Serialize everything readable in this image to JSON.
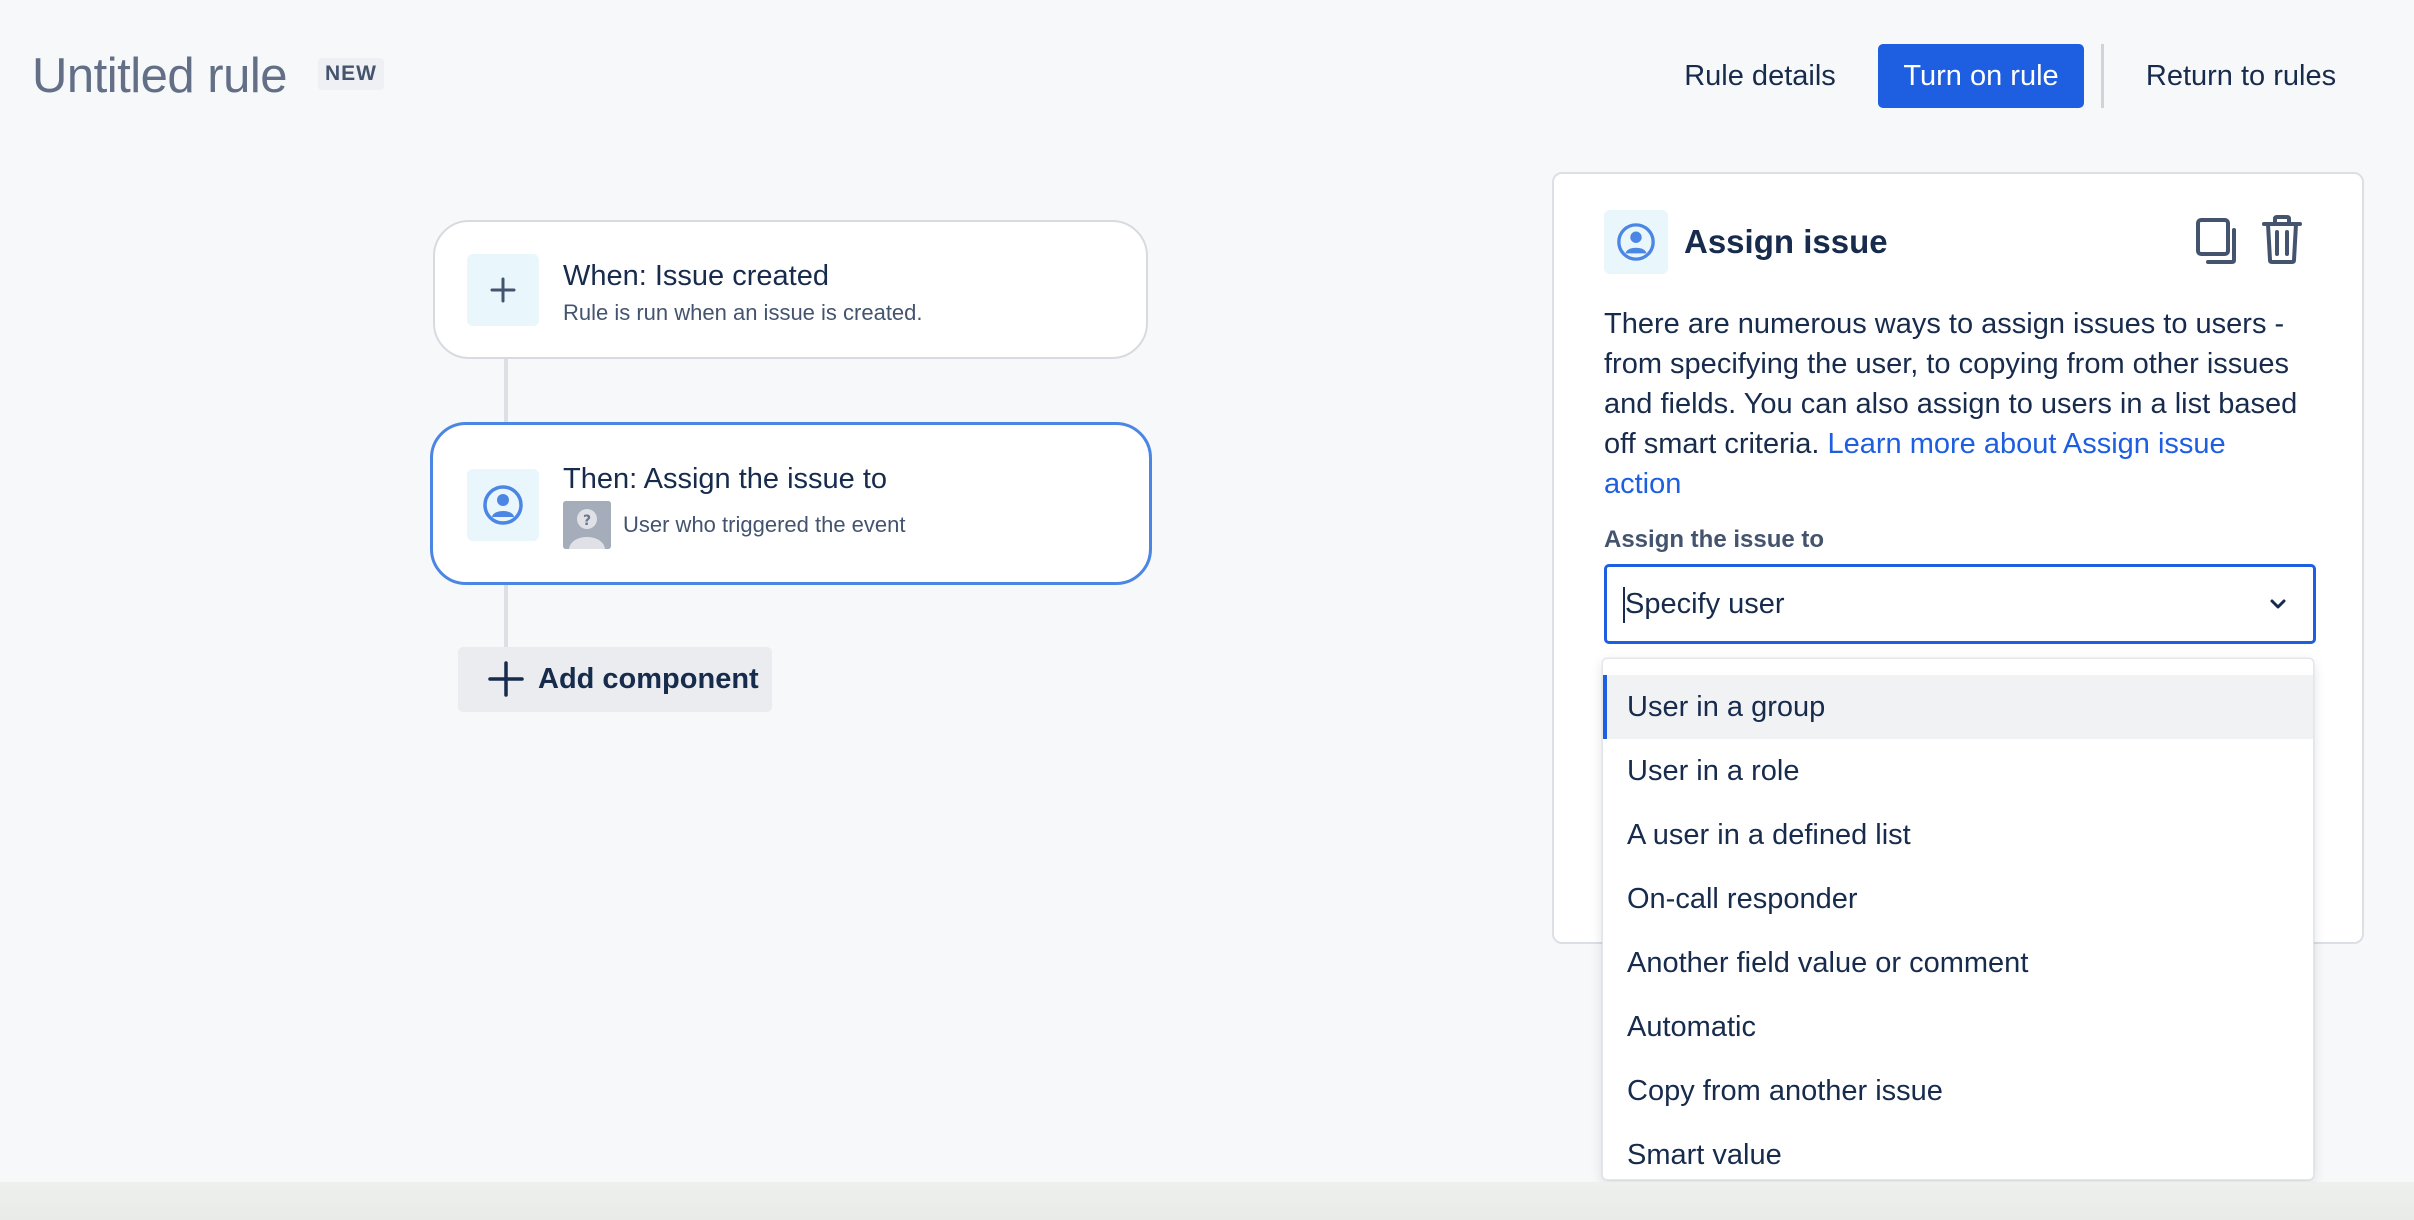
{
  "header": {
    "title": "Untitled rule",
    "badge": "NEW",
    "rule_details_label": "Rule details",
    "turn_on_label": "Turn on rule",
    "return_label": "Return to rules"
  },
  "flow": {
    "trigger": {
      "title": "When: Issue created",
      "subtitle": "Rule is run when an issue is created.",
      "icon": "plus-icon"
    },
    "action": {
      "title": "Then: Assign the issue to",
      "subtitle": "User who triggered the event",
      "icon": "user-avatar-icon"
    },
    "add_component_label": "Add component"
  },
  "panel": {
    "title": "Assign issue",
    "description": "There are numerous ways to assign issues to users - from specifying the user, to copying from other issues and fields. You can also assign to users in a list based off smart criteria.",
    "learn_more_link": "Learn more about Assign issue action",
    "field_label": "Assign the issue to",
    "selected_value": "Specify user"
  },
  "dropdown": {
    "options": [
      "User in a group",
      "User in a role",
      "A user in a defined list",
      "On-call responder",
      "Another field value or comment",
      "Automatic",
      "Copy from another issue",
      "Smart value"
    ],
    "highlighted_index": 0
  },
  "colors": {
    "accent": "#1d5fe0",
    "selected_card_border": "#4c86e5",
    "icon_bg": "#e9f6fb"
  }
}
